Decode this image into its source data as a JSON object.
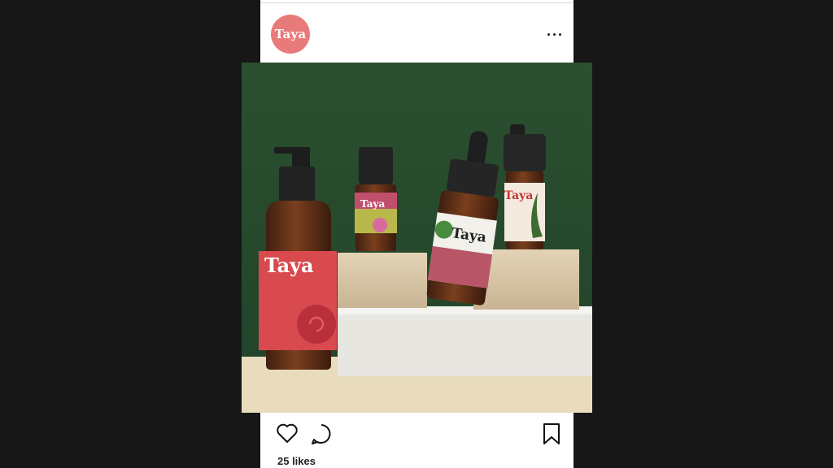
{
  "profile": {
    "avatar_text": "Taya",
    "avatar_color": "#e97a7a"
  },
  "post": {
    "bottle_labels": {
      "pump": "Taya",
      "small": "Taya",
      "dropper": "Taya",
      "tall": "Taya"
    },
    "likes": "25 likes"
  },
  "icons": [
    "more-options-icon",
    "heart-icon",
    "comment-icon",
    "bookmark-icon"
  ],
  "colors": {
    "background": "#171717",
    "card": "#ffffff",
    "brand": "#e97a7a",
    "backdrop": "#284a2c"
  }
}
